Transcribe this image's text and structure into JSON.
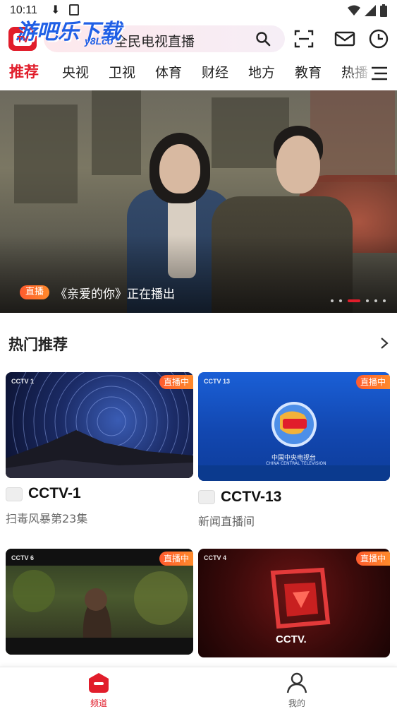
{
  "status_bar": {
    "time": "10:11"
  },
  "header": {
    "logo_text": "TV",
    "watermark": "游吧乐下载",
    "watermark_sub": "y8Lco"
  },
  "search": {
    "placeholder": "全民电视直播"
  },
  "tabs": [
    "推荐",
    "央视",
    "卫视",
    "体育",
    "财经",
    "地方",
    "教育",
    "热播"
  ],
  "banner": {
    "badge": "直播",
    "title": "《亲爱的你》正在播出",
    "dot_count": 6,
    "active_dot": 2
  },
  "hot": {
    "title": "热门推荐",
    "cards": [
      {
        "name": "CCTV-1",
        "program": "扫毒风暴第23集",
        "tag": "直播中",
        "icon": "cctv1-logo"
      },
      {
        "name": "CCTV-13",
        "program": "新闻直播间",
        "tag": "直播中",
        "icon": "cctv13-logo"
      },
      {
        "name": "CCTV-6",
        "program": "",
        "tag": "直播中",
        "icon": "cctv6-logo"
      },
      {
        "name": "CCTV-4",
        "program": "",
        "tag": "直播中",
        "icon": "cctv4-logo"
      }
    ],
    "thumb_text": {
      "c1": "CCTV 1",
      "c13_top": "CCTV 13",
      "c13_brand": "中国中央电视台",
      "c13_brand_en": "CHINA CENTRAL TELEVISION",
      "c6": "CCTV 6",
      "c4": "CCTV 4",
      "c4_brand": "CCTV."
    }
  },
  "bottom_nav": [
    {
      "label": "频道",
      "active": true
    },
    {
      "label": "我的",
      "active": false
    }
  ],
  "colors": {
    "accent": "#e11d2b",
    "live": "#ff6a2b"
  }
}
